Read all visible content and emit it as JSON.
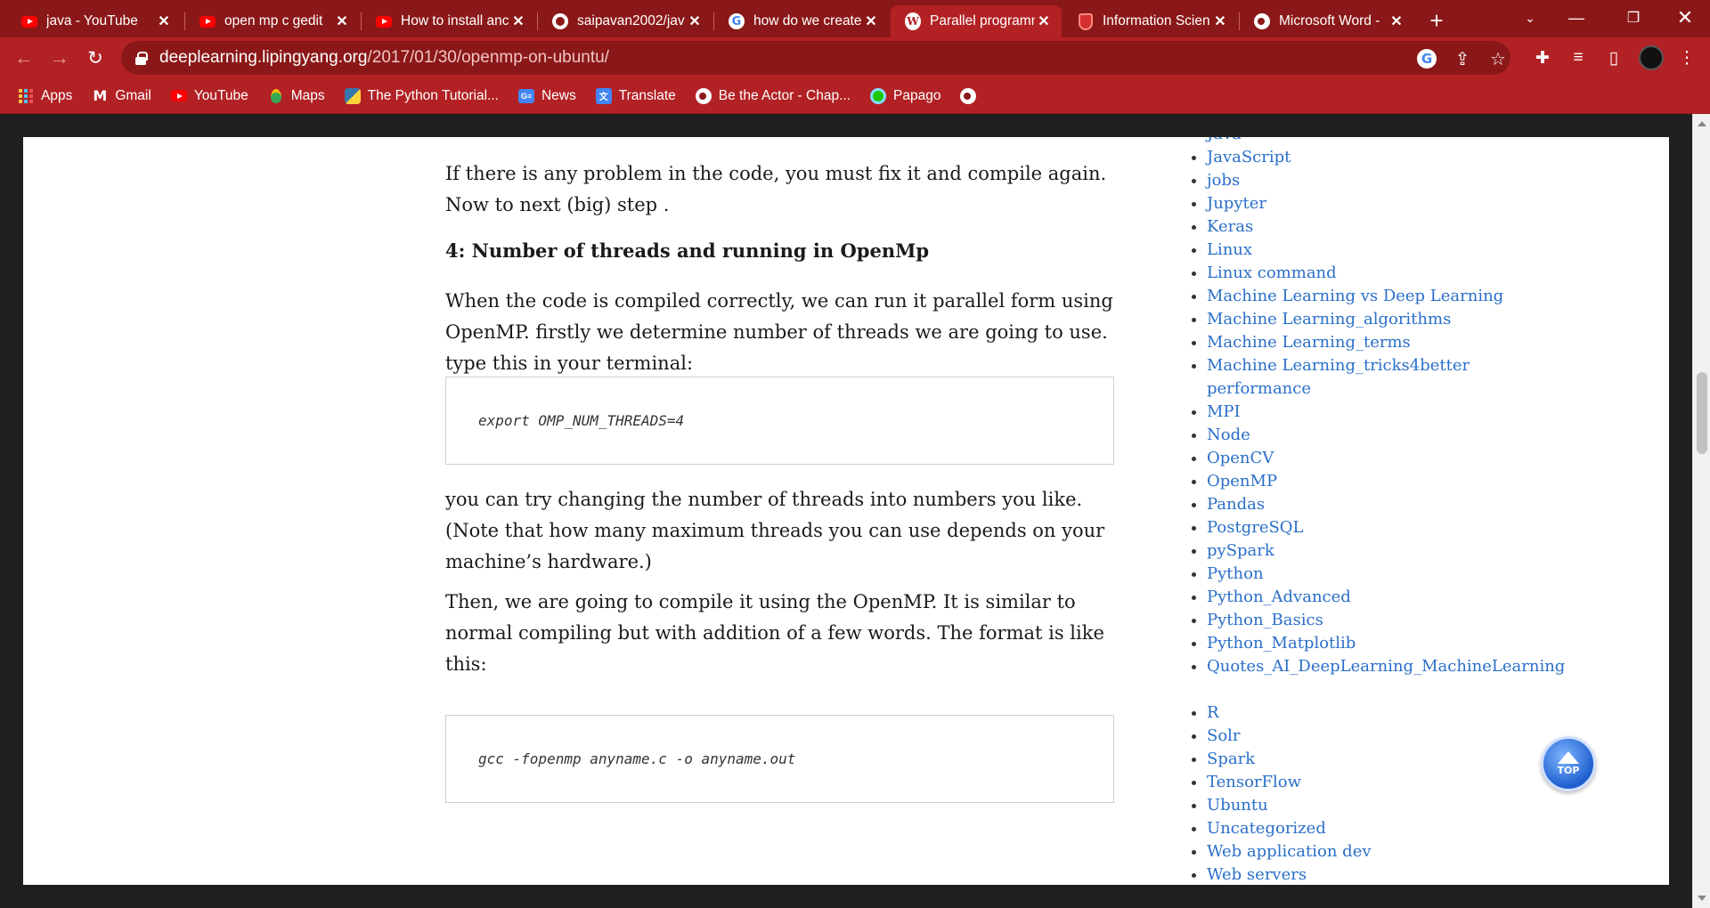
{
  "tabs": [
    {
      "title": "java - YouTube",
      "icon": "youtube-icon",
      "active": false
    },
    {
      "title": "open mp c gedit",
      "icon": "youtube-icon",
      "active": false
    },
    {
      "title": "How to install anc",
      "icon": "youtube-icon",
      "active": false
    },
    {
      "title": "saipavan2002/jav",
      "icon": "github-icon",
      "active": false
    },
    {
      "title": "how do we create",
      "icon": "google-icon",
      "active": false
    },
    {
      "title": "Parallel programm",
      "icon": "wordpress-icon",
      "active": true
    },
    {
      "title": "Information Scien",
      "icon": "shield-icon",
      "active": false
    },
    {
      "title": "Microsoft Word -",
      "icon": "globe-icon",
      "active": false
    }
  ],
  "address_bar": {
    "host": "deeplearning.lipingyang.org",
    "path": "/2017/01/30/openmp-on-ubuntu/"
  },
  "bookmarks": [
    {
      "label": "Apps",
      "icon": "apps-grid-icon"
    },
    {
      "label": "Gmail",
      "icon": "gmail-icon"
    },
    {
      "label": "YouTube",
      "icon": "youtube-icon"
    },
    {
      "label": "Maps",
      "icon": "maps-pin-icon"
    },
    {
      "label": "The Python Tutorial...",
      "icon": "python-icon"
    },
    {
      "label": "News",
      "icon": "google-news-icon"
    },
    {
      "label": "Translate",
      "icon": "google-translate-icon"
    },
    {
      "label": "Be the Actor - Chap...",
      "icon": "globe-icon"
    },
    {
      "label": "Papago",
      "icon": "papago-icon"
    }
  ],
  "article": {
    "para1": "If there is any problem in the code, you must fix it and compile again. Now to next (big) step .",
    "heading": "4: Number of threads and running in OpenMp",
    "para2": "When the code is compiled correctly, we can run it parallel form using OpenMP. firstly we determine number of threads we are going to use. type this in your terminal:",
    "code1": "export OMP_NUM_THREADS=4",
    "para3": "you can try changing the number of threads into numbers you like. (Note that how many maximum threads you can use depends on your machine’s hardware.)",
    "para4": "Then, we are going to compile it using the OpenMP. It is similar to normal compiling but with addition of a few words. The format is like this:",
    "code2": "gcc -fopenmp anyname.c -o anyname.out"
  },
  "sidebar": {
    "categories": [
      "Java",
      "JavaScript",
      "jobs",
      "Jupyter",
      "Keras",
      "Linux",
      "Linux command",
      "Machine Learning vs Deep Learning",
      "Machine Learning_algorithms",
      "Machine Learning_terms",
      "Machine Learning_tricks4better performance",
      "MPI",
      "Node",
      "OpenCV",
      "OpenMP",
      "Pandas",
      "PostgreSQL",
      "pySpark",
      "Python",
      "Python_Advanced",
      "Python_Basics",
      "Python_Matplotlib",
      "Quotes_AI_DeepLearning_MachineLearning",
      "R",
      "Solr",
      "Spark",
      "TensorFlow",
      "Ubuntu",
      "Uncategorized",
      "Web application dev",
      "Web servers"
    ]
  },
  "top_button": {
    "label": "TOP"
  },
  "colors": {
    "tab_strip": "#8b1818",
    "toolbar": "#b22124",
    "link": "#2a6fc9"
  }
}
